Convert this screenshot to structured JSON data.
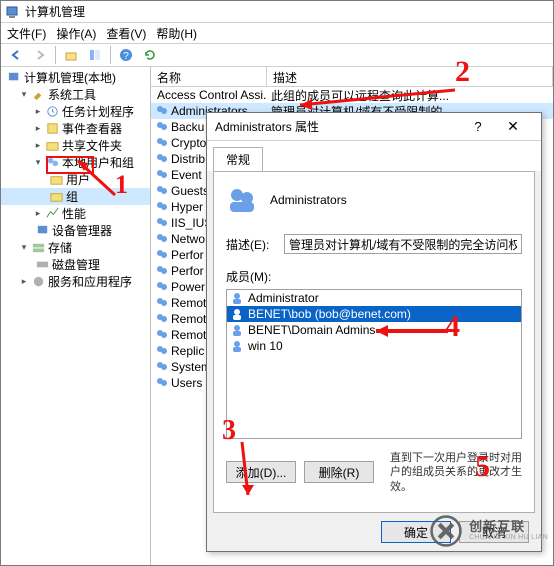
{
  "window": {
    "title": "计算机管理",
    "menu": [
      "文件(F)",
      "操作(A)",
      "查看(V)",
      "帮助(H)"
    ]
  },
  "tree": {
    "root": "计算机管理(本地)",
    "system_tools": "系统工具",
    "task_scheduler": "任务计划程序",
    "event_viewer": "事件查看器",
    "shared_folders": "共享文件夹",
    "local_users": "本地用户和组",
    "users": "用户",
    "groups": "组",
    "performance": "性能",
    "device_manager": "设备管理器",
    "storage": "存储",
    "disk_mgmt": "磁盘管理",
    "services_apps": "服务和应用程序"
  },
  "list": {
    "col_name": "名称",
    "col_desc": "描述",
    "rows": [
      {
        "name": "Access Control Assi...",
        "desc": "此组的成员可以远程查询此计算..."
      },
      {
        "name": "Administrators",
        "desc": "管理员对计算机/域有不受限制的..."
      },
      {
        "name": "Backu",
        "desc": ""
      },
      {
        "name": "Crypto",
        "desc": ""
      },
      {
        "name": "Distrib",
        "desc": ""
      },
      {
        "name": "Event L",
        "desc": ""
      },
      {
        "name": "Guests",
        "desc": ""
      },
      {
        "name": "Hyper",
        "desc": ""
      },
      {
        "name": "IIS_IUS",
        "desc": ""
      },
      {
        "name": "Netwo",
        "desc": ""
      },
      {
        "name": "Perfor",
        "desc": ""
      },
      {
        "name": "Perfor",
        "desc": ""
      },
      {
        "name": "Power",
        "desc": ""
      },
      {
        "name": "Remot",
        "desc": ""
      },
      {
        "name": "Remot",
        "desc": ""
      },
      {
        "name": "Remot",
        "desc": ""
      },
      {
        "name": "Replic",
        "desc": ""
      },
      {
        "name": "System",
        "desc": ""
      },
      {
        "name": "Users",
        "desc": ""
      }
    ]
  },
  "dialog": {
    "title": "Administrators 属性",
    "tab": "常规",
    "group_name": "Administrators",
    "desc_label": "描述(E):",
    "desc_value": "管理员对计算机/域有不受限制的完全访问权",
    "members_label": "成员(M):",
    "members": [
      "Administrator",
      "BENET\\bob (bob@benet.com)",
      "BENET\\Domain Admins",
      "win 10"
    ],
    "selected_member_index": 1,
    "add": "添加(D)...",
    "remove": "删除(R)",
    "hint": "直到下一次用户登录时对用户的组成员关系的更改才生效。",
    "ok": "确定",
    "cancel": "取消"
  },
  "annotations": {
    "a1": "1",
    "a2": "2",
    "a3": "3",
    "a4": "4",
    "a5": "5"
  },
  "watermark": {
    "cn": "创新互联",
    "en": "CHUANG XIN HU LIAN"
  }
}
